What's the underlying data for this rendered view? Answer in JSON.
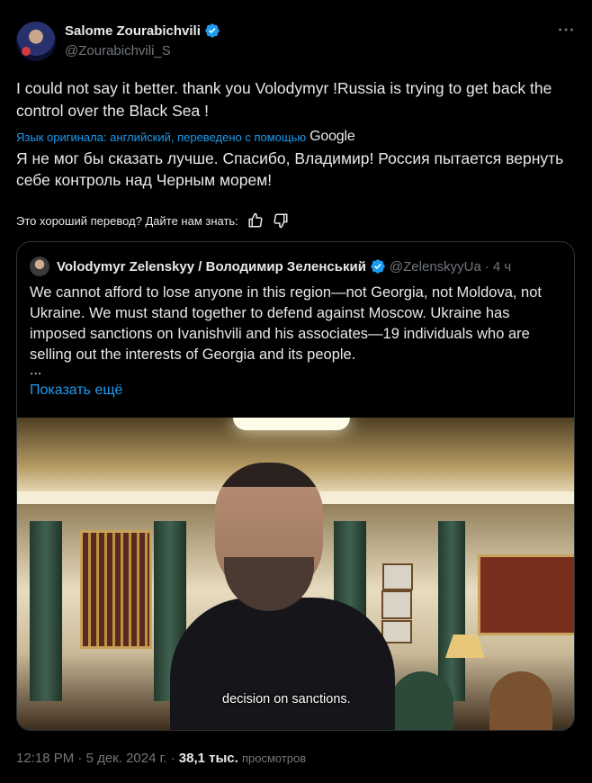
{
  "author": {
    "name": "Salome Zourabichvili",
    "handle": "@Zourabichvili_S"
  },
  "tweet": {
    "text": "I could not say it better. thank you Volodymyr !Russia is trying to get back the control over the Black Sea !",
    "translation_note": "Язык оригинала: английский, переведено с помощью",
    "translation_provider": "Google",
    "translated_text": "Я не мог бы сказать лучше. Спасибо, Владимир! Россия пытается вернуть себе контроль над Черным морем!",
    "feedback_prompt": "Это хороший перевод? Дайте нам знать:"
  },
  "quote": {
    "name": "Volodymyr Zelenskyy / Володимир Зеленський",
    "handle": "@ZelenskyyUa",
    "separator": "·",
    "time": "4 ч",
    "text": "We cannot afford to lose anyone in this region—not Georgia, not Moldova, not Ukraine. We must stand together to defend against Moscow. Ukraine has imposed sanctions on Ivanishvili and his associates—19 individuals who are selling out the interests of Georgia and its people.",
    "ellipsis": "...",
    "show_more": "Показать ещё",
    "video_caption": "decision on sanctions."
  },
  "footer": {
    "time": "12:18 PM",
    "dot1": "·",
    "date": "5 дек. 2024 г.",
    "dot2": "·",
    "views_count": "38,1 тыс.",
    "views_label": "просмотров"
  },
  "icons": {
    "verified": "verified-badge-icon",
    "more": "more-icon",
    "thumbs_up": "thumbs-up-icon",
    "thumbs_down": "thumbs-down-icon"
  },
  "colors": {
    "background": "#000000",
    "text": "#e7e9ea",
    "secondary": "#71767b",
    "link": "#1d9bf0",
    "border": "#2f3336"
  }
}
